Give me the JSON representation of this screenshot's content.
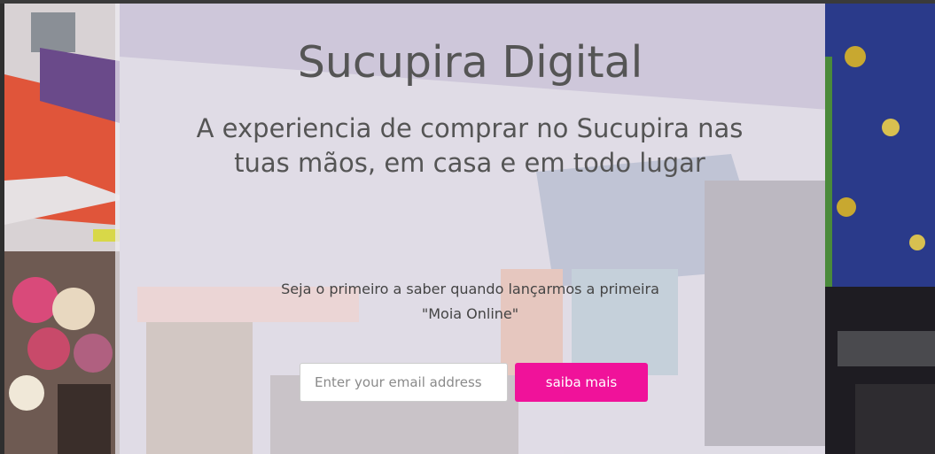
{
  "hero": {
    "title": "Sucupira Digital",
    "subtitle": "A experiencia de comprar no Sucupira nas tuas mãos, em casa e em todo lugar",
    "lead_line1": "Seja o primeiro a saber quando lançarmos a primeira",
    "lead_line2": "\"Moia Online\""
  },
  "signup": {
    "email_value": "",
    "email_placeholder": "Enter your email address",
    "button_label": "saiba mais"
  },
  "colors": {
    "accent": "#f0129a",
    "panel": "#eeecf2",
    "text": "#555555"
  }
}
